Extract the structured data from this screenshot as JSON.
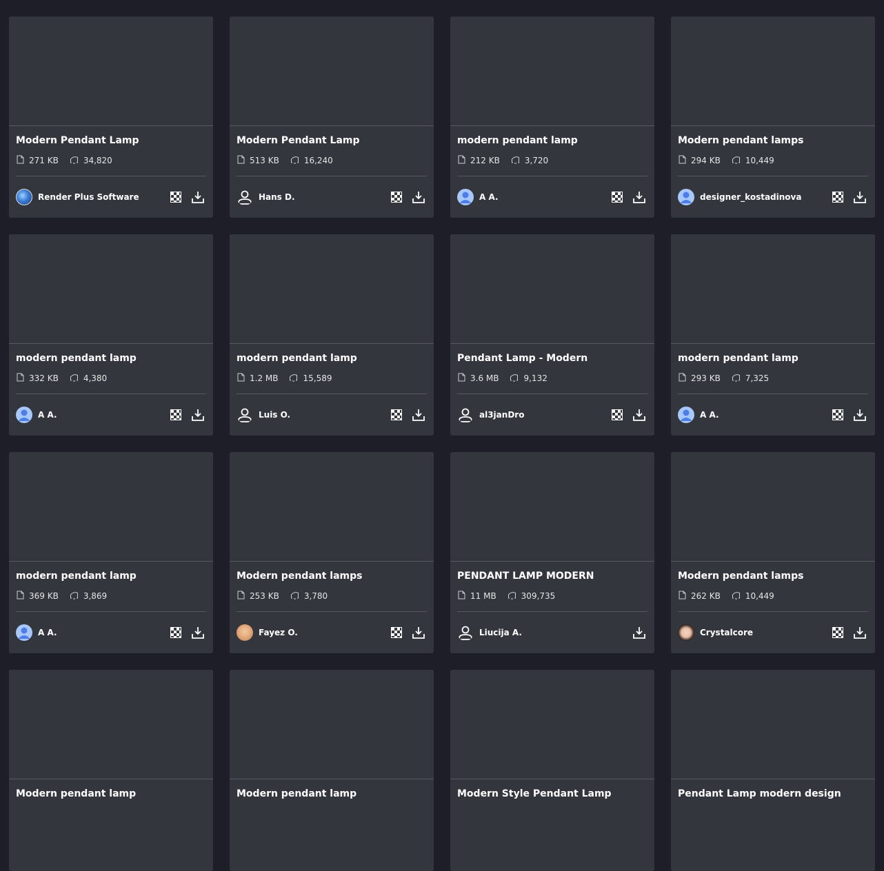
{
  "colors": {
    "page_bg": "#1e1e28",
    "card_bg": "#33363d",
    "divider": "#555a62",
    "text": "#ffffff"
  },
  "cards": [
    {
      "title": "Modern Pendant Lamp",
      "size": "271 KB",
      "downloads": "34,820",
      "author": "Render Plus Software",
      "avatar": "globe-avatar",
      "viewer": true
    },
    {
      "title": "Modern Pendant Lamp",
      "size": "513 KB",
      "downloads": "16,240",
      "author": "Hans D.",
      "avatar": "outline-user-icon",
      "viewer": true
    },
    {
      "title": "modern pendant lamp",
      "size": "212 KB",
      "downloads": "3,720",
      "author": "A A.",
      "avatar": "default-user-icon",
      "viewer": true
    },
    {
      "title": "Modern pendant lamps",
      "size": "294 KB",
      "downloads": "10,449",
      "author": "designer_kostadinova",
      "avatar": "default-user-icon",
      "viewer": true
    },
    {
      "title": "modern pendant lamp",
      "size": "332 KB",
      "downloads": "4,380",
      "author": "A A.",
      "avatar": "default-user-icon",
      "viewer": true
    },
    {
      "title": "modern pendant lamp",
      "size": "1.2 MB",
      "downloads": "15,589",
      "author": "Luis O.",
      "avatar": "outline-user-icon",
      "viewer": true
    },
    {
      "title": "Pendant Lamp - Modern",
      "size": "3.6 MB",
      "downloads": "9,132",
      "author": "al3janDro",
      "avatar": "outline-user-icon",
      "viewer": true
    },
    {
      "title": "modern pendant lamp",
      "size": "293 KB",
      "downloads": "7,325",
      "author": "A A.",
      "avatar": "default-user-icon",
      "viewer": true
    },
    {
      "title": "modern pendant lamp",
      "size": "369 KB",
      "downloads": "3,869",
      "author": "A A.",
      "avatar": "default-user-icon",
      "viewer": true
    },
    {
      "title": "Modern pendant lamps",
      "size": "253 KB",
      "downloads": "3,780",
      "author": "Fayez O.",
      "avatar": "photo-avatar-1",
      "viewer": true
    },
    {
      "title": "PENDANT LAMP MODERN",
      "size": "11 MB",
      "downloads": "309,735",
      "author": "Liucija A.",
      "avatar": "outline-user-icon",
      "viewer": false
    },
    {
      "title": "Modern pendant lamps",
      "size": "262 KB",
      "downloads": "10,449",
      "author": "Crystalcore",
      "avatar": "photo-avatar-2",
      "viewer": true
    },
    {
      "title": "Modern pendant lamp"
    },
    {
      "title": "Modern pendant lamp"
    },
    {
      "title": "Modern Style Pendant Lamp"
    },
    {
      "title": "Pendant Lamp modern design"
    }
  ]
}
